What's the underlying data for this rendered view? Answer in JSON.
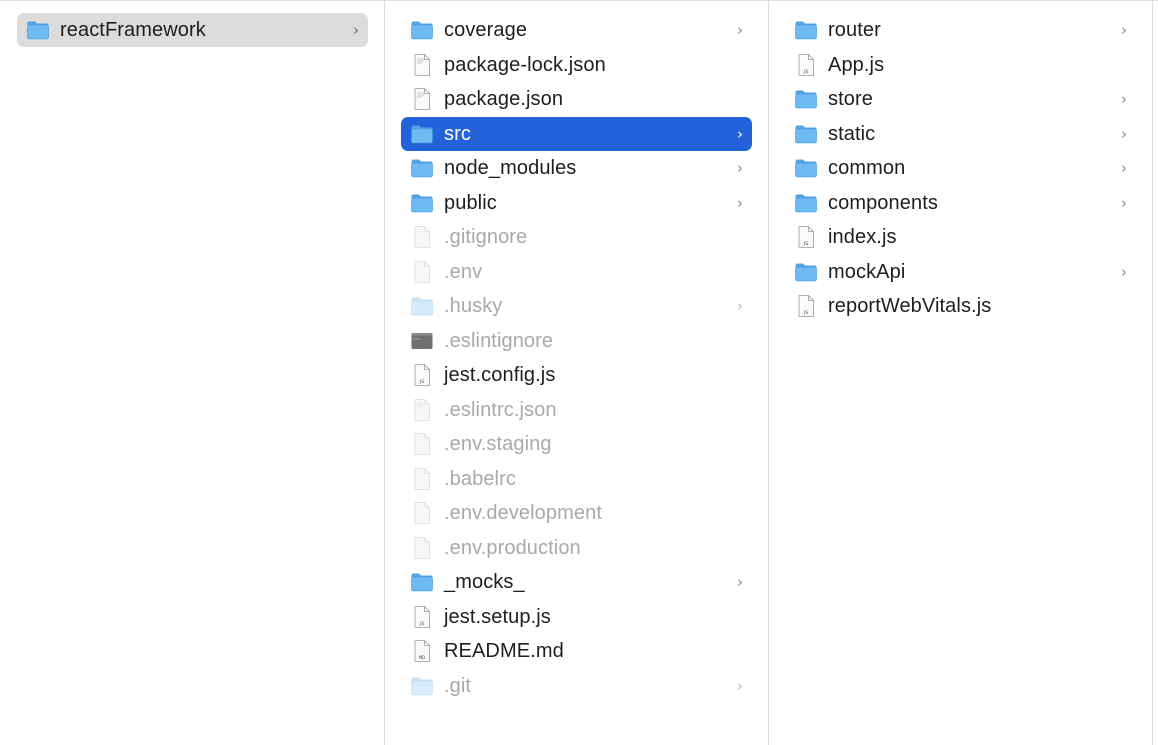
{
  "columns": [
    {
      "items": [
        {
          "name": "reactFramework",
          "kind": "folder",
          "chevron": true,
          "state": "parent"
        }
      ]
    },
    {
      "items": [
        {
          "name": "coverage",
          "kind": "folder",
          "chevron": true,
          "state": "normal"
        },
        {
          "name": "package-lock.json",
          "kind": "doc",
          "chevron": false,
          "state": "normal"
        },
        {
          "name": "package.json",
          "kind": "doc",
          "chevron": false,
          "state": "normal"
        },
        {
          "name": "src",
          "kind": "folder",
          "chevron": true,
          "state": "selected"
        },
        {
          "name": "node_modules",
          "kind": "folder",
          "chevron": true,
          "state": "normal"
        },
        {
          "name": "public",
          "kind": "folder",
          "chevron": true,
          "state": "normal"
        },
        {
          "name": ".gitignore",
          "kind": "blank",
          "chevron": false,
          "state": "dim"
        },
        {
          "name": ".env",
          "kind": "blank",
          "chevron": false,
          "state": "dim"
        },
        {
          "name": ".husky",
          "kind": "folder",
          "chevron": true,
          "state": "dim"
        },
        {
          "name": ".eslintignore",
          "kind": "exec",
          "chevron": false,
          "state": "dim"
        },
        {
          "name": "jest.config.js",
          "kind": "js",
          "chevron": false,
          "state": "normal"
        },
        {
          "name": ".eslintrc.json",
          "kind": "doc",
          "chevron": false,
          "state": "dim"
        },
        {
          "name": ".env.staging",
          "kind": "blank",
          "chevron": false,
          "state": "dim"
        },
        {
          "name": ".babelrc",
          "kind": "blank",
          "chevron": false,
          "state": "dim"
        },
        {
          "name": ".env.development",
          "kind": "blank",
          "chevron": false,
          "state": "dim"
        },
        {
          "name": ".env.production",
          "kind": "blank",
          "chevron": false,
          "state": "dim"
        },
        {
          "name": "_mocks_",
          "kind": "folder",
          "chevron": true,
          "state": "normal"
        },
        {
          "name": "jest.setup.js",
          "kind": "js",
          "chevron": false,
          "state": "normal"
        },
        {
          "name": "README.md",
          "kind": "md",
          "chevron": false,
          "state": "normal"
        },
        {
          "name": ".git",
          "kind": "folder",
          "chevron": true,
          "state": "dim"
        }
      ]
    },
    {
      "items": [
        {
          "name": "router",
          "kind": "folder",
          "chevron": true,
          "state": "normal"
        },
        {
          "name": "App.js",
          "kind": "js",
          "chevron": false,
          "state": "normal"
        },
        {
          "name": "store",
          "kind": "folder",
          "chevron": true,
          "state": "normal"
        },
        {
          "name": "static",
          "kind": "folder",
          "chevron": true,
          "state": "normal"
        },
        {
          "name": "common",
          "kind": "folder",
          "chevron": true,
          "state": "normal"
        },
        {
          "name": "components",
          "kind": "folder",
          "chevron": true,
          "state": "normal"
        },
        {
          "name": "index.js",
          "kind": "js",
          "chevron": false,
          "state": "normal"
        },
        {
          "name": "mockApi",
          "kind": "folder",
          "chevron": true,
          "state": "normal"
        },
        {
          "name": "reportWebVitals.js",
          "kind": "js",
          "chevron": false,
          "state": "normal"
        }
      ]
    }
  ],
  "icons": {
    "folder": "folder-icon",
    "doc": "document-icon",
    "js": "js-file-icon",
    "md": "markdown-file-icon",
    "blank": "blank-file-icon",
    "exec": "executable-file-icon",
    "chevron": "chevron-right-icon"
  },
  "chevron_glyph": "›",
  "colors": {
    "selection": "#2362d9",
    "parent_highlight": "#dcdcdc",
    "folder_blue": "#5aaef0",
    "dim_text": "#a9a9a9"
  }
}
